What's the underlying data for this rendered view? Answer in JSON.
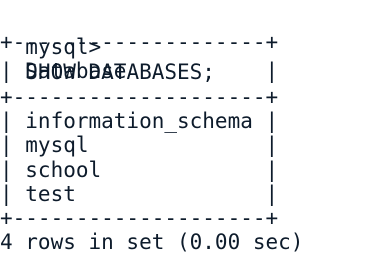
{
  "terminal": {
    "prompt": "mysql>",
    "command": "SHOW DATABASES;",
    "border": "+--------------------+",
    "column_header": "| Database           |",
    "rows": [
      "| information_schema |",
      "| mysql              |",
      "| school             |",
      "| test               |"
    ],
    "result_summary": "4 rows in set (0.00 sec)"
  },
  "colors": {
    "text": "#0d1b2b",
    "background": "#ffffff"
  }
}
